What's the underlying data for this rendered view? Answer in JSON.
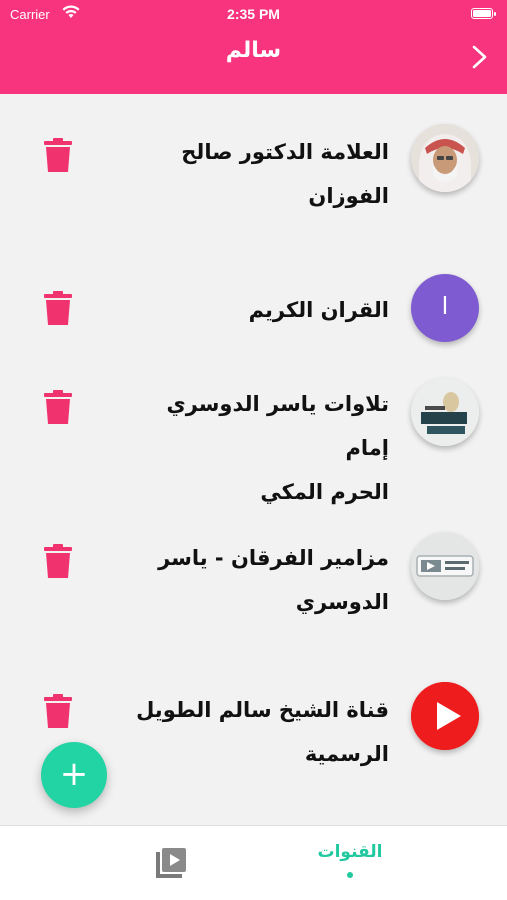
{
  "status_bar": {
    "carrier": "Carrier",
    "time": "2:35 PM"
  },
  "header": {
    "title": "سالم",
    "back_icon": "chevron-right-icon"
  },
  "channels": [
    {
      "title_line1": "العلامة الدكتور صالح",
      "title_line2": "الفوزان",
      "avatar": "sheikh-portrait-image"
    },
    {
      "title_line1": "القران الكريم",
      "title_line2": "",
      "avatar_letter": "ا",
      "avatar_color": "#7e5bd0"
    },
    {
      "title_line1": "تلاوات ياسر الدوسري إمام",
      "title_line2": "الحرم المكي",
      "avatar": "channel-logo-image"
    },
    {
      "title_line1": "مزامير الفرقان - ياسر",
      "title_line2": "الدوسري",
      "avatar": "channel-logo-image"
    },
    {
      "title_line1": "قناة الشيخ سالم الطويل",
      "title_line2": "الرسمية",
      "avatar": "youtube-play-icon",
      "avatar_color": "#ee1c1c"
    }
  ],
  "fab": {
    "label": "+"
  },
  "tabbar": {
    "channels_label": "القنوات",
    "media_icon": "video-library-icon"
  },
  "colors": {
    "header": "#f7347d",
    "trash": "#f0336f",
    "accent": "#22c9a0",
    "fab": "#22d3a3"
  }
}
